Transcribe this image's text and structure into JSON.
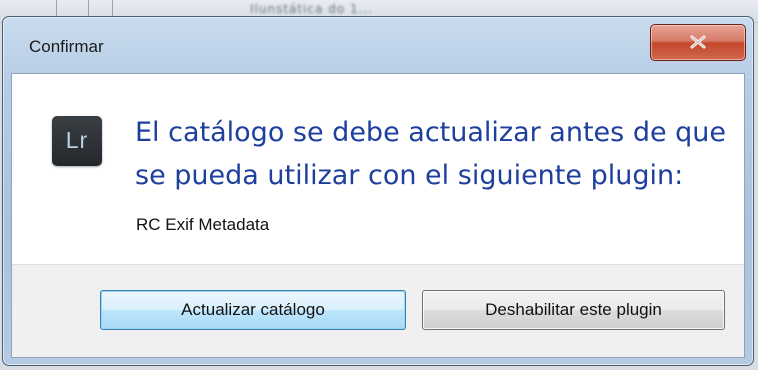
{
  "background": {
    "blurred_text": "Ilunstática do 1..."
  },
  "dialog": {
    "title": "Confirmar",
    "close_icon": "close-icon",
    "app_icon": {
      "name": "lightroom-icon",
      "label": "Lr"
    },
    "message": "El catálogo se debe actualizar antes de que se pueda utilizar con el siguiente plugin:",
    "plugin_name": "RC Exif Metadata",
    "buttons": {
      "update_label": "Actualizar catálogo",
      "disable_label": "Deshabilitar este plugin"
    }
  },
  "colors": {
    "message_text": "#1e3f9e",
    "close_button": "#c4472c",
    "primary_button_border": "#3c7fb1"
  }
}
